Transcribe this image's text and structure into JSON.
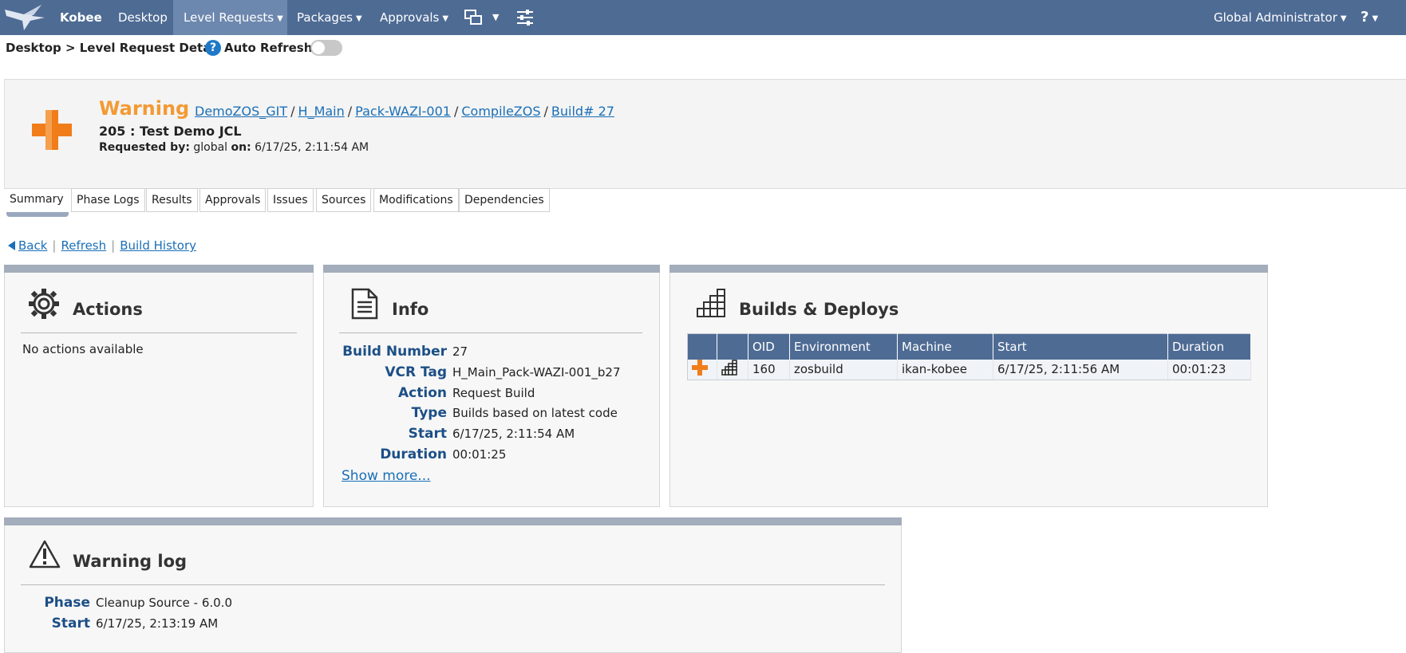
{
  "nav": {
    "brand": "Kobee",
    "items": [
      "Desktop",
      "Level Requests",
      "Packages",
      "Approvals"
    ],
    "user": "Global Administrator",
    "help": "?"
  },
  "breadcrumb": {
    "text": "Desktop > Level Request Detail",
    "auto_refresh_label": "Auto Refresh",
    "auto_refresh_on": false
  },
  "header": {
    "status": "Warning",
    "path": [
      "DemoZOS_GIT",
      "H_Main",
      "Pack-WAZI-001",
      "CompileZOS",
      "Build# 27"
    ],
    "request_title": "205 : Test Demo JCL",
    "requested_by_label": "Requested by:",
    "requested_by": "global",
    "on_label": "on:",
    "requested_on": "6/17/25, 2:11:54 AM"
  },
  "tabs": [
    "Summary",
    "Phase Logs",
    "Results",
    "Approvals",
    "Issues",
    "Sources",
    "Modifications",
    "Dependencies"
  ],
  "active_tab": "Summary",
  "links": {
    "back": "Back",
    "refresh": "Refresh",
    "history": "Build History"
  },
  "actions": {
    "title": "Actions",
    "empty": "No actions available"
  },
  "info": {
    "title": "Info",
    "rows": [
      {
        "label": "Build Number",
        "value": "27"
      },
      {
        "label": "VCR Tag",
        "value": "H_Main_Pack-WAZI-001_b27"
      },
      {
        "label": "Action",
        "value": "Request Build"
      },
      {
        "label": "Type",
        "value": "Builds based on latest code"
      },
      {
        "label": "Start",
        "value": "6/17/25, 2:11:54 AM"
      },
      {
        "label": "Duration",
        "value": "00:01:25"
      }
    ],
    "show_more": "Show more..."
  },
  "builds": {
    "title": "Builds & Deploys",
    "columns": [
      "",
      "",
      "OID",
      "Environment",
      "Machine",
      "Start",
      "Duration"
    ],
    "rows": [
      {
        "oid": "160",
        "environment": "zosbuild",
        "machine": "ikan-kobee",
        "start": "6/17/25, 2:11:56 AM",
        "duration": "00:01:23"
      }
    ]
  },
  "warning_log": {
    "title": "Warning log",
    "rows": [
      {
        "label": "Phase",
        "value": "Cleanup Source - 6.0.0"
      },
      {
        "label": "Start",
        "value": "6/17/25, 2:13:19 AM"
      }
    ]
  },
  "colors": {
    "nav": "#4e6b94",
    "warning": "#f39a34",
    "link": "#1a6fb7",
    "label": "#1c4f86"
  }
}
